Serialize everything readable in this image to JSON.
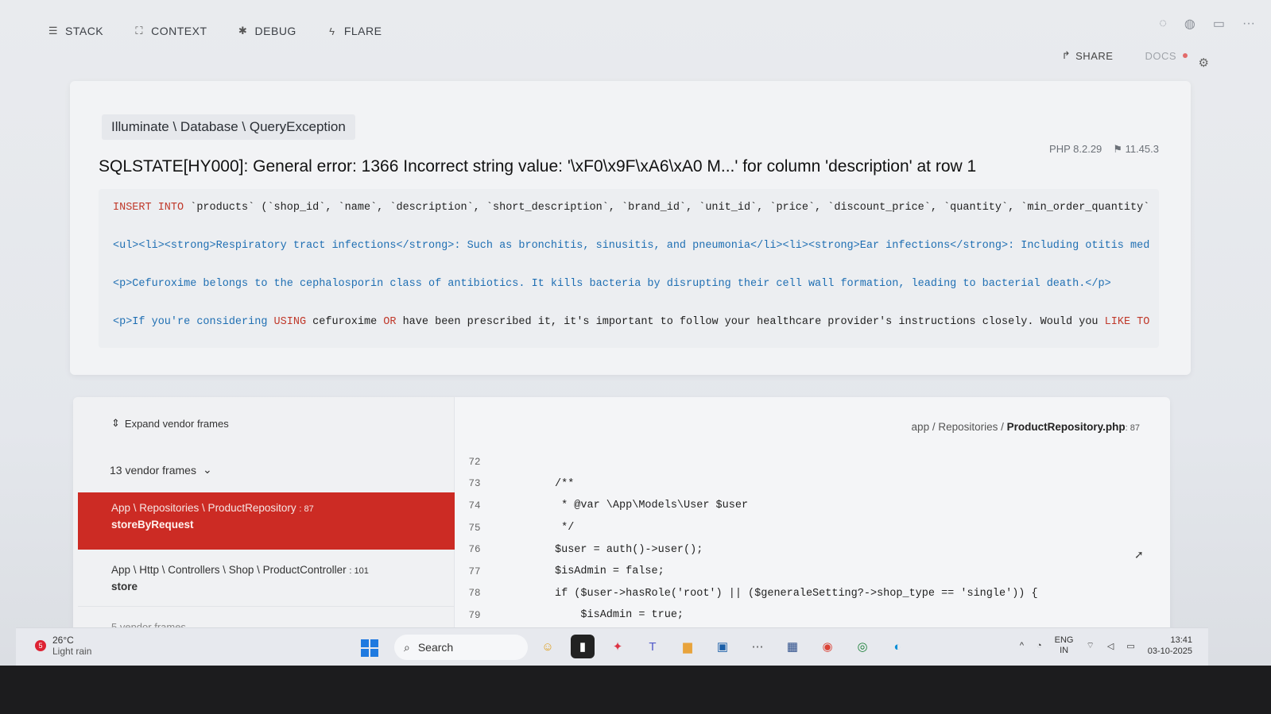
{
  "nav": {
    "stack": "STACK",
    "context": "CONTEXT",
    "debug": "DEBUG",
    "flare": "FLARE"
  },
  "actions": {
    "share": "SHARE",
    "docs": "DOCS"
  },
  "error": {
    "exception_class": "Illuminate \\ Database \\ QueryException",
    "php_version": "PHP 8.2.29",
    "laravel_version": "11.45.3",
    "message": "SQLSTATE[HY000]: General error: 1366 Incorrect string value: '\\xF0\\x9F\\xA6\\xA0 M...' for column 'description' at row 1"
  },
  "sql": {
    "line1_kw": "INSERT INTO",
    "line1_rest": " `products` (`shop_id`, `name`, `description`, `short_description`, `brand_id`, `unit_id`, `price`, `discount_price`, `quantity`, `min_order_quantity`",
    "line2": "<ul><li><strong>Respiratory tract infections</strong>: Such as bronchitis, sinusitis, and pneumonia</li><li><strong>Ear infections</strong>: Including otitis med",
    "line3": "<p>Cefuroxime belongs to the cephalosporin class of antibiotics. It kills bacteria by disrupting their cell wall formation, leading to bacterial death.</p>",
    "line4_a": "<p>If you're considering ",
    "line4_kw1": "USING",
    "line4_b": " cefuroxime ",
    "line4_kw2": "OR",
    "line4_c": " have been prescribed it, it's important to follow your healthcare provider's instructions closely. Would you ",
    "line4_kw3": "LIKE TO"
  },
  "frames": {
    "expand_label": "Expand vendor frames",
    "vendor_frames_label": "13 vendor frames",
    "active": {
      "class": "App \\ Repositories \\ ProductRepository",
      "line": ": 87",
      "method": "storeByRequest"
    },
    "second": {
      "class": "App \\ Http \\ Controllers \\ Shop \\ ProductController",
      "line": ": 101",
      "method": "store"
    },
    "third_label": "5 vendor frames"
  },
  "code": {
    "file_dir": "app / Repositories / ",
    "file_name": "ProductRepository.php",
    "file_line": ": 87",
    "lines": [
      {
        "num": "72",
        "text": ""
      },
      {
        "num": "73",
        "text": "/**"
      },
      {
        "num": "74",
        "text": " * @var \\App\\Models\\User $user"
      },
      {
        "num": "75",
        "text": " */"
      },
      {
        "num": "76",
        "text": "$user = auth()->user();"
      },
      {
        "num": "77",
        "text": "$isAdmin = false;"
      },
      {
        "num": "78",
        "text": "if ($user->hasRole('root') || ($generaleSetting?->shop_type == 'single')) {"
      },
      {
        "num": "79",
        "text": "    $isAdmin = true;"
      }
    ]
  },
  "taskbar": {
    "weather_temp": "26°C",
    "weather_desc": "Light rain",
    "weather_badge": "5",
    "search": "Search",
    "lang1": "ENG",
    "lang2": "IN",
    "time": "13:41",
    "date": "03-10-2025"
  },
  "colors": {
    "active_frame": "#cc2b24",
    "sql_keyword": "#c0392b",
    "sql_html": "#1f6fb3"
  }
}
